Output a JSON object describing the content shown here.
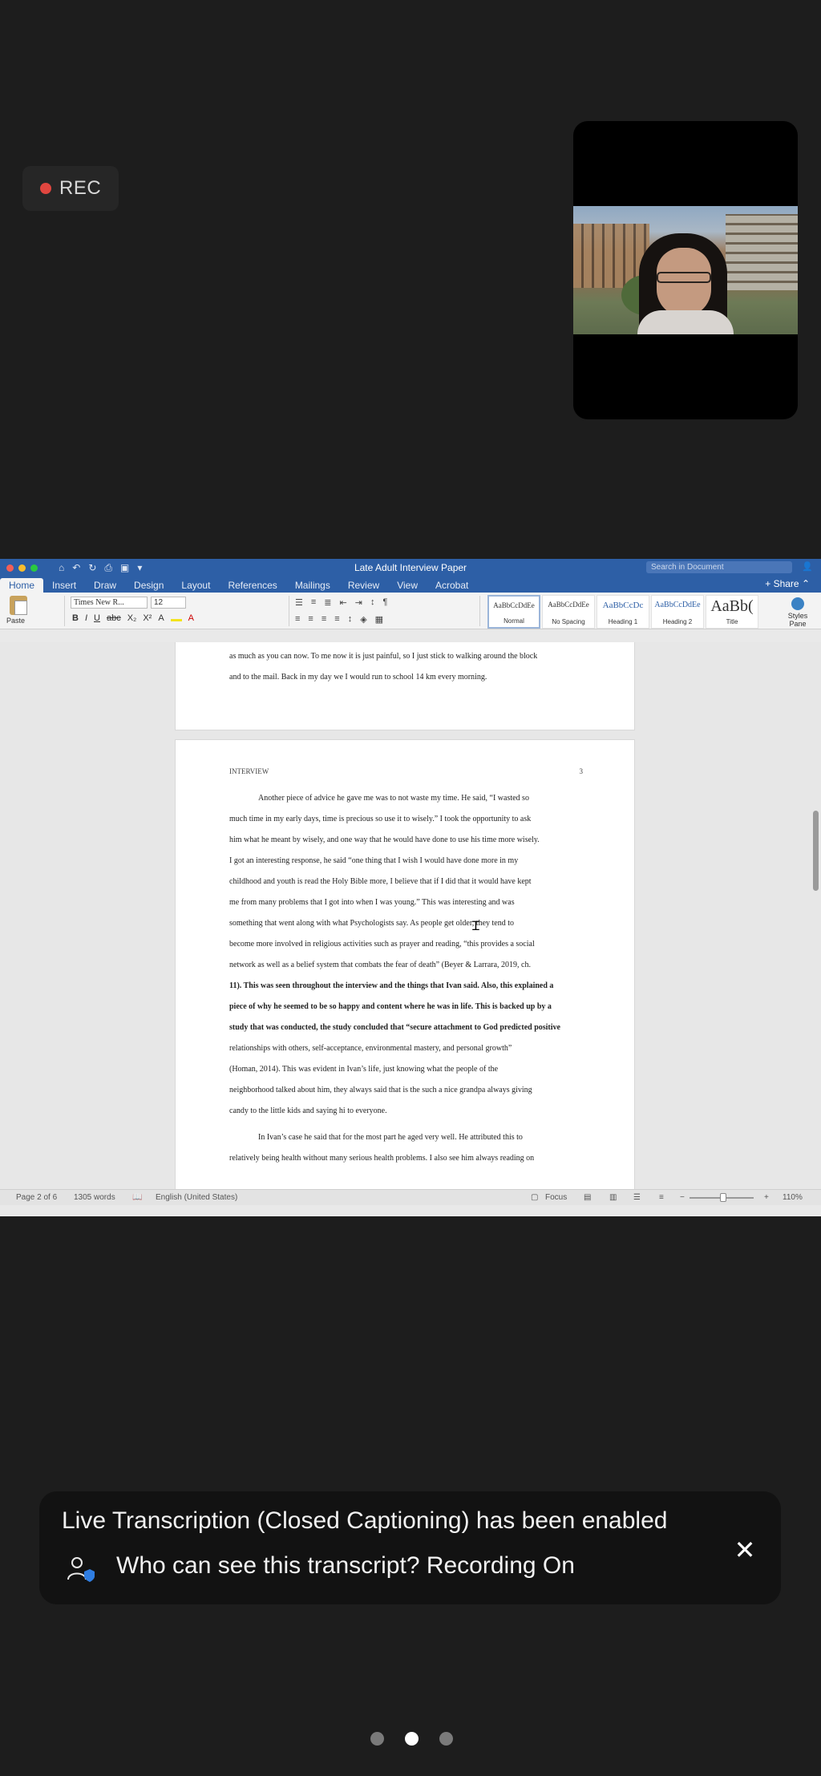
{
  "rec": {
    "label": "REC"
  },
  "word": {
    "title": "Late Adult Interview Paper",
    "search_placeholder": "Search in Document",
    "tabs": [
      "Home",
      "Insert",
      "Draw",
      "Design",
      "Layout",
      "References",
      "Mailings",
      "Review",
      "View",
      "Acrobat"
    ],
    "share_label": "Share",
    "paste_label": "Paste",
    "font_name": "Times New R...",
    "font_size": "12",
    "styles": [
      {
        "sample": "AaBbCcDdEe",
        "name": "Normal"
      },
      {
        "sample": "AaBbCcDdEe",
        "name": "No Spacing"
      },
      {
        "sample": "AaBbCcDc",
        "name": "Heading 1"
      },
      {
        "sample": "AaBbCcDdEe",
        "name": "Heading 2"
      },
      {
        "sample": "AaBb(",
        "name": "Title"
      }
    ],
    "styles_pane": "Styles Pane",
    "page1_lines": [
      "as much as you can now. To me now it is just painful, so I just stick to walking around the block",
      "and to the mail. Back in my day we I would run to school 14 km every morning."
    ],
    "running_head": "INTERVIEW",
    "page_number": "3",
    "page2_lines": [
      "Another piece of advice he gave me was to not waste my time. He said, “I wasted so",
      "much time in my early days, time is precious so use it to wisely.” I took the opportunity to ask",
      "him what he meant by wisely, and one way that he would have done to use his time more wisely.",
      "I got an interesting response, he said “one thing that I wish I would have done more in my",
      "childhood and youth is read the Holy Bible more, I believe that if I did that it would have kept",
      "me from many problems that I got into when I was young.” This was interesting and was",
      "something that went along with what Psychologists say. As people get older, they tend to",
      "become more involved in religious activities such as prayer and reading, “this provides a social",
      "network as well as a belief system that combats the fear of death” (Beyer & Larrara, 2019, ch.",
      "11). This was seen throughout the interview and the things that Ivan said. Also, this explained a",
      "piece of why he seemed to be so happy and content where he was in life. This is backed up by a",
      "study that was conducted, the study concluded that “secure attachment to God predicted positive",
      "relationships with others, self-acceptance, environmental mastery, and personal growth”",
      "(Homan, 2014). This was evident in Ivan’s life, just knowing what the people of the",
      "neighborhood talked about him, they always said that is the such a nice grandpa always giving",
      "candy to the little kids and saying hi to everyone.",
      "In Ivan’s case he said that for the most part he aged very well. He attributed this to",
      "relatively being health without many serious health problems. I also see him always reading on"
    ],
    "status": {
      "page": "Page 2 of 6",
      "words": "1305 words",
      "language": "English (United States)",
      "focus": "Focus",
      "zoom": "110%"
    }
  },
  "caption": {
    "line1": "Live Transcription (Closed Captioning) has been enabled",
    "line2": "Who can see this transcript? Recording On"
  },
  "pager": {
    "count": 3,
    "active": 1
  }
}
